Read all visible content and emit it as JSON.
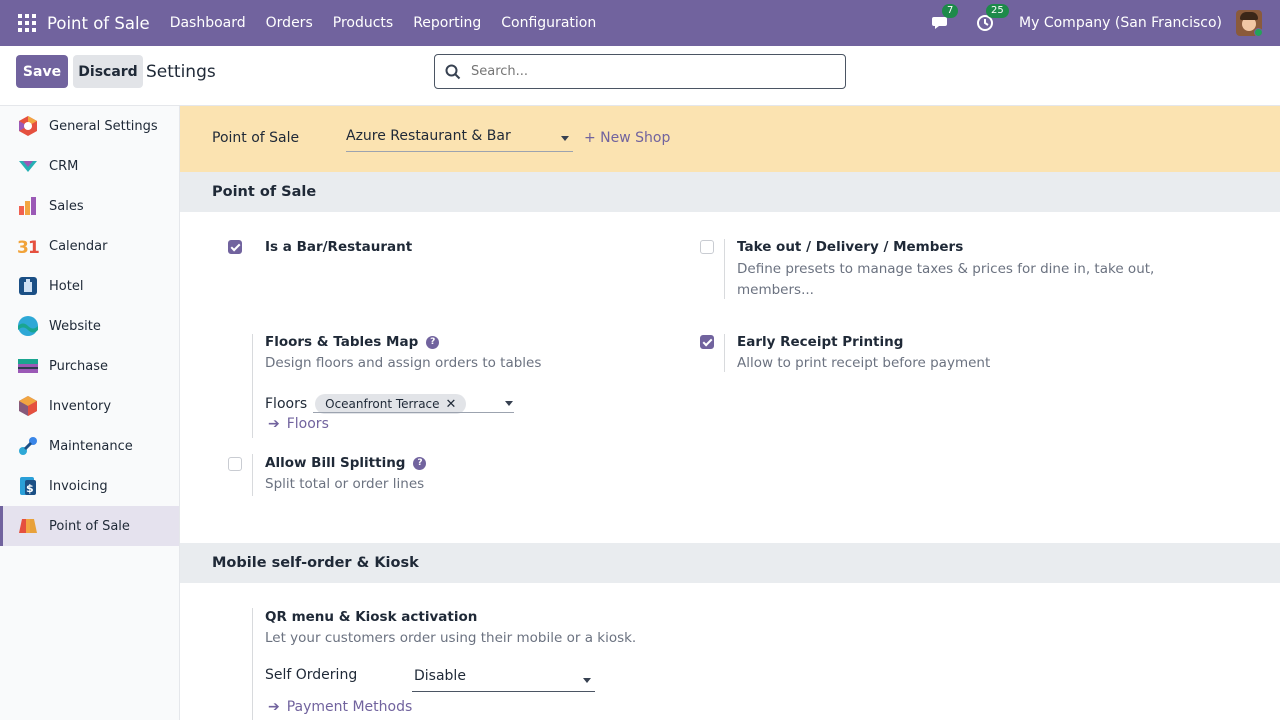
{
  "navbar": {
    "app_name": "Point of Sale",
    "menu": [
      "Dashboard",
      "Orders",
      "Products",
      "Reporting",
      "Configuration"
    ],
    "messages_count": "7",
    "activities_count": "25",
    "company": "My Company (San Francisco)"
  },
  "control": {
    "save_label": "Save",
    "discard_label": "Discard",
    "title": "Settings",
    "search_placeholder": "Search..."
  },
  "sidebar": {
    "items": [
      {
        "label": "General Settings",
        "icon": "general-settings-icon",
        "color": "#e5503f"
      },
      {
        "label": "CRM",
        "icon": "crm-icon",
        "color": "#27b0b5"
      },
      {
        "label": "Sales",
        "icon": "sales-icon",
        "color": "#f06050"
      },
      {
        "label": "Calendar",
        "icon": "calendar-icon",
        "color": "#f1a33a"
      },
      {
        "label": "Hotel",
        "icon": "hotel-icon",
        "color": "#1b4f85"
      },
      {
        "label": "Website",
        "icon": "website-icon",
        "color": "#2ea8d6"
      },
      {
        "label": "Purchase",
        "icon": "purchase-icon",
        "color": "#1aa590"
      },
      {
        "label": "Inventory",
        "icon": "inventory-icon",
        "color": "#875a7b"
      },
      {
        "label": "Maintenance",
        "icon": "maintenance-icon",
        "color": "#3a86e8"
      },
      {
        "label": "Invoicing",
        "icon": "invoicing-icon",
        "color": "#2a9fd8"
      },
      {
        "label": "Point of Sale",
        "icon": "point-of-sale-icon",
        "color": "#e8a13a"
      }
    ],
    "active_index": 10
  },
  "shop": {
    "label": "Point of Sale",
    "selected": "Azure Restaurant & Bar",
    "new_shop": "+ New Shop"
  },
  "pos_section": {
    "heading": "Point of Sale",
    "bar_restaurant": {
      "title": "Is a Bar/Restaurant",
      "checked": true
    },
    "takeout": {
      "title": "Take out / Delivery / Members",
      "desc_line1": "Define presets to manage taxes & prices for dine in, take out,",
      "desc_line2": "members...",
      "checked": false
    },
    "floors": {
      "title": "Floors & Tables Map",
      "desc": "Design floors and assign orders to tables",
      "field_label": "Floors",
      "tag": "Oceanfront Terrace",
      "link": "Floors"
    },
    "early_receipt": {
      "title": "Early Receipt Printing",
      "desc": "Allow to print receipt before payment",
      "checked": true
    },
    "bill_split": {
      "title": "Allow Bill Splitting",
      "desc": "Split total or order lines",
      "checked": false
    }
  },
  "kiosk_section": {
    "heading": "Mobile self-order & Kiosk",
    "qr": {
      "title": "QR menu & Kiosk activation",
      "desc": "Let your customers order using their mobile or a kiosk."
    },
    "self_ordering": {
      "label": "Self Ordering",
      "value": "Disable"
    },
    "payment_link": "Payment Methods"
  }
}
